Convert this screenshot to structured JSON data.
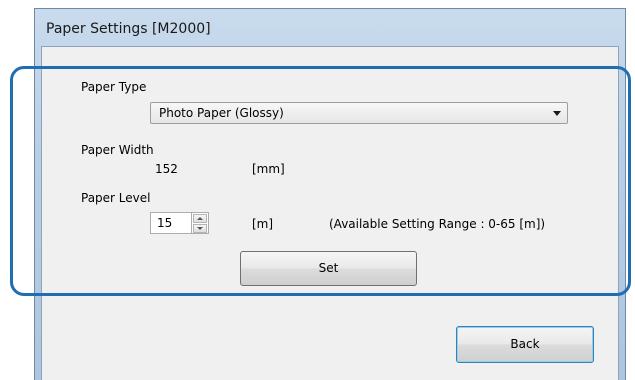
{
  "window": {
    "title": "Paper Settings [M2000]"
  },
  "paper_type": {
    "label": "Paper Type",
    "selected": "Photo Paper (Glossy)"
  },
  "paper_width": {
    "label": "Paper Width",
    "value": "152",
    "unit": "[mm]"
  },
  "paper_level": {
    "label": "Paper Level",
    "value": "15",
    "unit": "[m]",
    "range_note": "(Available Setting Range : 0-65 [m])"
  },
  "buttons": {
    "set": "Set",
    "back": "Back"
  },
  "colors": {
    "callout": "#1f6db2",
    "client_bg": "#f0f0f0"
  }
}
